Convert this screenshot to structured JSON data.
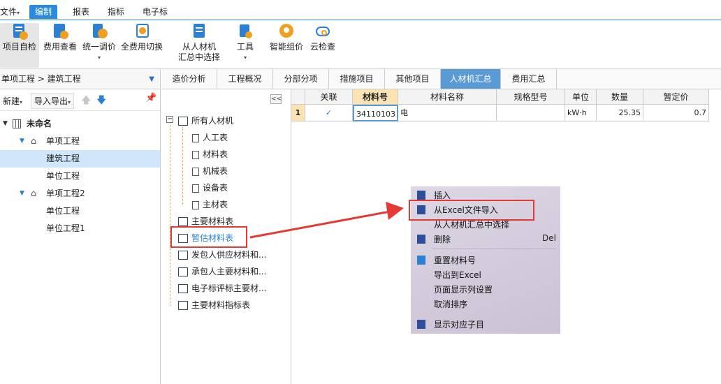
{
  "menu": {
    "file": "文件",
    "edit": "编制",
    "report": "报表",
    "index": "指标",
    "etender": "电子标"
  },
  "ribbon": [
    {
      "name": "project-check",
      "l1": "项目自检",
      "l2": "",
      "caret": false
    },
    {
      "name": "fee-view",
      "l1": "费用查看",
      "l2": "",
      "caret": false
    },
    {
      "name": "unified-price",
      "l1": "统一调价",
      "l2": "",
      "caret": true
    },
    {
      "name": "full-fee-switch",
      "l1": "全费用切换",
      "l2": "",
      "caret": false
    },
    {
      "name": "select-from-summary",
      "l1": "从人材机",
      "l2": "汇总中选择",
      "caret": false
    },
    {
      "name": "tools",
      "l1": "工具",
      "l2": "",
      "caret": true
    },
    {
      "name": "smart-pricing",
      "l1": "智能组价",
      "l2": "",
      "caret": false
    },
    {
      "name": "cloud-check",
      "l1": "云检查",
      "l2": "",
      "caret": false
    }
  ],
  "left": {
    "breadcrumb": "单项工程 > 建筑工程",
    "new_label": "新建",
    "import_export_label": "导入导出",
    "tree": [
      {
        "label": "未命名",
        "level": 0,
        "bold": true
      },
      {
        "label": "单项工程",
        "level": 1
      },
      {
        "label": "建筑工程",
        "level": 2,
        "selected": true
      },
      {
        "label": "单位工程",
        "level": 2
      },
      {
        "label": "单项工程2",
        "level": 1
      },
      {
        "label": "单位工程",
        "level": 2
      },
      {
        "label": "单位工程1",
        "level": 2
      }
    ]
  },
  "tabs": [
    "造价分析",
    "工程概况",
    "分部分项",
    "措施项目",
    "其他项目",
    "人材机汇总",
    "费用汇总"
  ],
  "active_tab": "人材机汇总",
  "category_tree": {
    "collapse_label": "<<",
    "root": "所有人材机",
    "children": [
      "人工表",
      "材料表",
      "机械表",
      "设备表",
      "主材表"
    ],
    "groups": [
      "主要材料表",
      "暂估材料表",
      "发包人供应材料和...",
      "承包人主要材料和...",
      "电子标评标主要材...",
      "主要材料指标表"
    ]
  },
  "grid": {
    "headers": [
      "",
      "关联",
      "材料号",
      "材料名称",
      "规格型号",
      "单位",
      "数量",
      "暂定价"
    ],
    "row": {
      "index": "1",
      "code": "34110103",
      "name": "电",
      "spec": "",
      "unit": "kW·h",
      "qty": "25.35",
      "price": "0.7"
    }
  },
  "context_menu": {
    "items": [
      "插入",
      "从Excel文件导入",
      "从人材机汇总中选择",
      "删除",
      "重置材料号",
      "导出到Excel",
      "页面显示列设置",
      "取消排序",
      "显示对应子目"
    ],
    "delete_shortcut": "Del"
  },
  "colors": {
    "accent": "#2b8be0",
    "highlight_box": "#e53935",
    "arrow": "#e53935",
    "active_tab": "#5b9bd5",
    "tree_selected": "#cfe6fb"
  }
}
